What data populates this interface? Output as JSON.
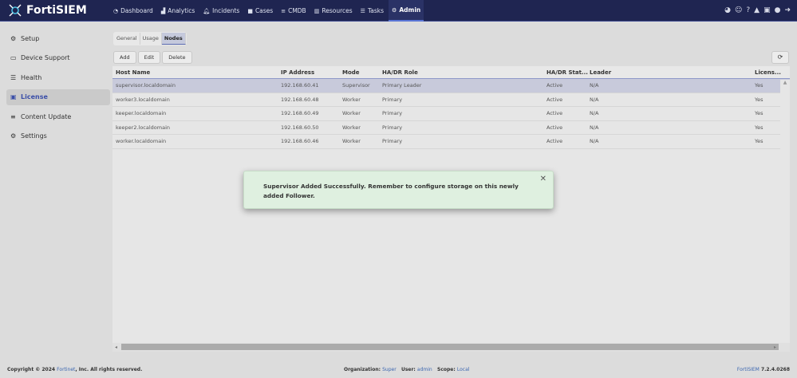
{
  "app": {
    "name": "FortiSIEM",
    "version_label": "FortiSIEM",
    "version": "7.2.4.0268"
  },
  "nav": [
    {
      "label": "Dashboard",
      "icon": "tachometer-icon"
    },
    {
      "label": "Analytics",
      "icon": "area-chart-icon"
    },
    {
      "label": "Incidents",
      "icon": "bell-icon"
    },
    {
      "label": "Cases",
      "icon": "folder-icon"
    },
    {
      "label": "CMDB",
      "icon": "database-icon"
    },
    {
      "label": "Resources",
      "icon": "bar-chart-icon"
    },
    {
      "label": "Tasks",
      "icon": "list-icon"
    },
    {
      "label": "Admin",
      "icon": "cogs-icon",
      "active": true
    }
  ],
  "header_icons": [
    "palette-icon",
    "robot-icon",
    "help-icon",
    "warning-icon",
    "id-card-icon",
    "user-icon",
    "logout-icon"
  ],
  "sidebar": [
    {
      "label": "Setup",
      "icon": "gear-icon"
    },
    {
      "label": "Device Support",
      "icon": "hdd-icon"
    },
    {
      "label": "Health",
      "icon": "server-icon"
    },
    {
      "label": "License",
      "icon": "id-card-icon",
      "active": true
    },
    {
      "label": "Content Update",
      "icon": "database-icon"
    },
    {
      "label": "Settings",
      "icon": "cogs-icon"
    }
  ],
  "tabs": [
    {
      "label": "General"
    },
    {
      "label": "Usage"
    },
    {
      "label": "Nodes",
      "active": true
    }
  ],
  "toolbar": {
    "add": "Add",
    "edit": "Edit",
    "delete": "Delete"
  },
  "table": {
    "columns": [
      "Host Name",
      "IP Address",
      "Mode",
      "HA/DR Role",
      "HA/DR Stat...",
      "Leader",
      "Licens..."
    ],
    "rows": [
      [
        "supervisor.localdomain",
        "192.168.60.41",
        "Supervisor",
        "Primary Leader",
        "Active",
        "N/A",
        "Yes"
      ],
      [
        "worker3.localdomain",
        "192.168.60.48",
        "Worker",
        "Primary",
        "Active",
        "N/A",
        "Yes"
      ],
      [
        "keeper.localdomain",
        "192.168.60.49",
        "Worker",
        "Primary",
        "Active",
        "N/A",
        "Yes"
      ],
      [
        "keeper2.localdomain",
        "192.168.60.50",
        "Worker",
        "Primary",
        "Active",
        "N/A",
        "Yes"
      ],
      [
        "worker.localdomain",
        "192.168.60.46",
        "Worker",
        "Primary",
        "Active",
        "N/A",
        "Yes"
      ]
    ]
  },
  "toast": {
    "message": "Supervisor Added Successfully. Remember to configure storage on this newly added Follower."
  },
  "footer": {
    "copyright_pre": "Copyright © 2024",
    "company": "Fortinet",
    "copyright_post": ", Inc. All rights reserved.",
    "org_label": "Organization:",
    "org": "Super",
    "user_label": "User:",
    "user": "admin",
    "scope_label": "Scope:",
    "scope": "Local"
  }
}
